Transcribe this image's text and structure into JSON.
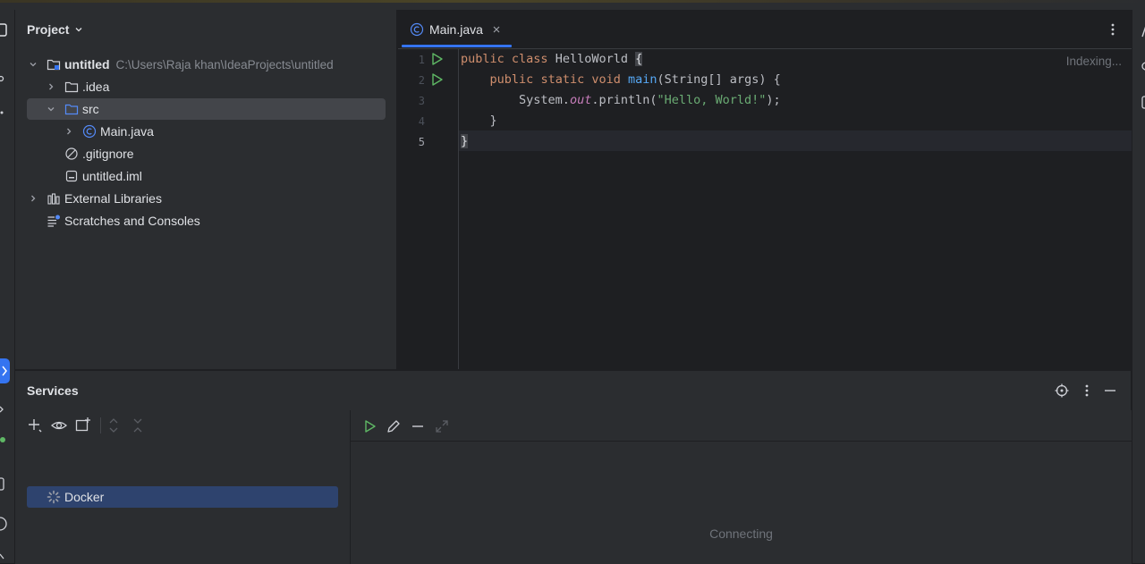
{
  "project_panel": {
    "title": "Project",
    "tree": [
      {
        "label": "untitled",
        "path": "C:\\Users\\Raja khan\\IdeaProjects\\untitled"
      },
      {
        "label": ".idea"
      },
      {
        "label": "src"
      },
      {
        "label": "Main.java"
      },
      {
        "label": ".gitignore"
      },
      {
        "label": "untitled.iml"
      },
      {
        "label": "External Libraries"
      },
      {
        "label": "Scratches and Consoles"
      }
    ]
  },
  "editor": {
    "tab_label": "Main.java",
    "status": "Indexing...",
    "line_numbers": [
      "1",
      "2",
      "3",
      "4",
      "5"
    ],
    "code": {
      "l1_kw1": "public",
      "l1_kw2": "class",
      "l1_name": "HelloWorld",
      "l1_brace": "{",
      "l2_kw1": "public",
      "l2_kw2": "static",
      "l2_kw3": "void",
      "l2_fn": "main",
      "l2_rest": "(String[] args) {",
      "l3_a": "System.",
      "l3_field": "out",
      "l3_b": ".println(",
      "l3_str": "\"Hello, World!\"",
      "l3_c": ");",
      "l4": "}",
      "l5": "}"
    }
  },
  "services": {
    "title": "Services",
    "items": [
      {
        "label": "Docker"
      }
    ],
    "status": "Connecting"
  },
  "colors": {
    "background": "#1e1f22",
    "panel": "#2b2d30",
    "accent": "#3574f0",
    "keyword": "#cf8e6d",
    "function": "#56a8f5",
    "string": "#6aab73",
    "field": "#c77dbb",
    "run_gutter": "#5fb865",
    "selection": "#2e436e"
  }
}
